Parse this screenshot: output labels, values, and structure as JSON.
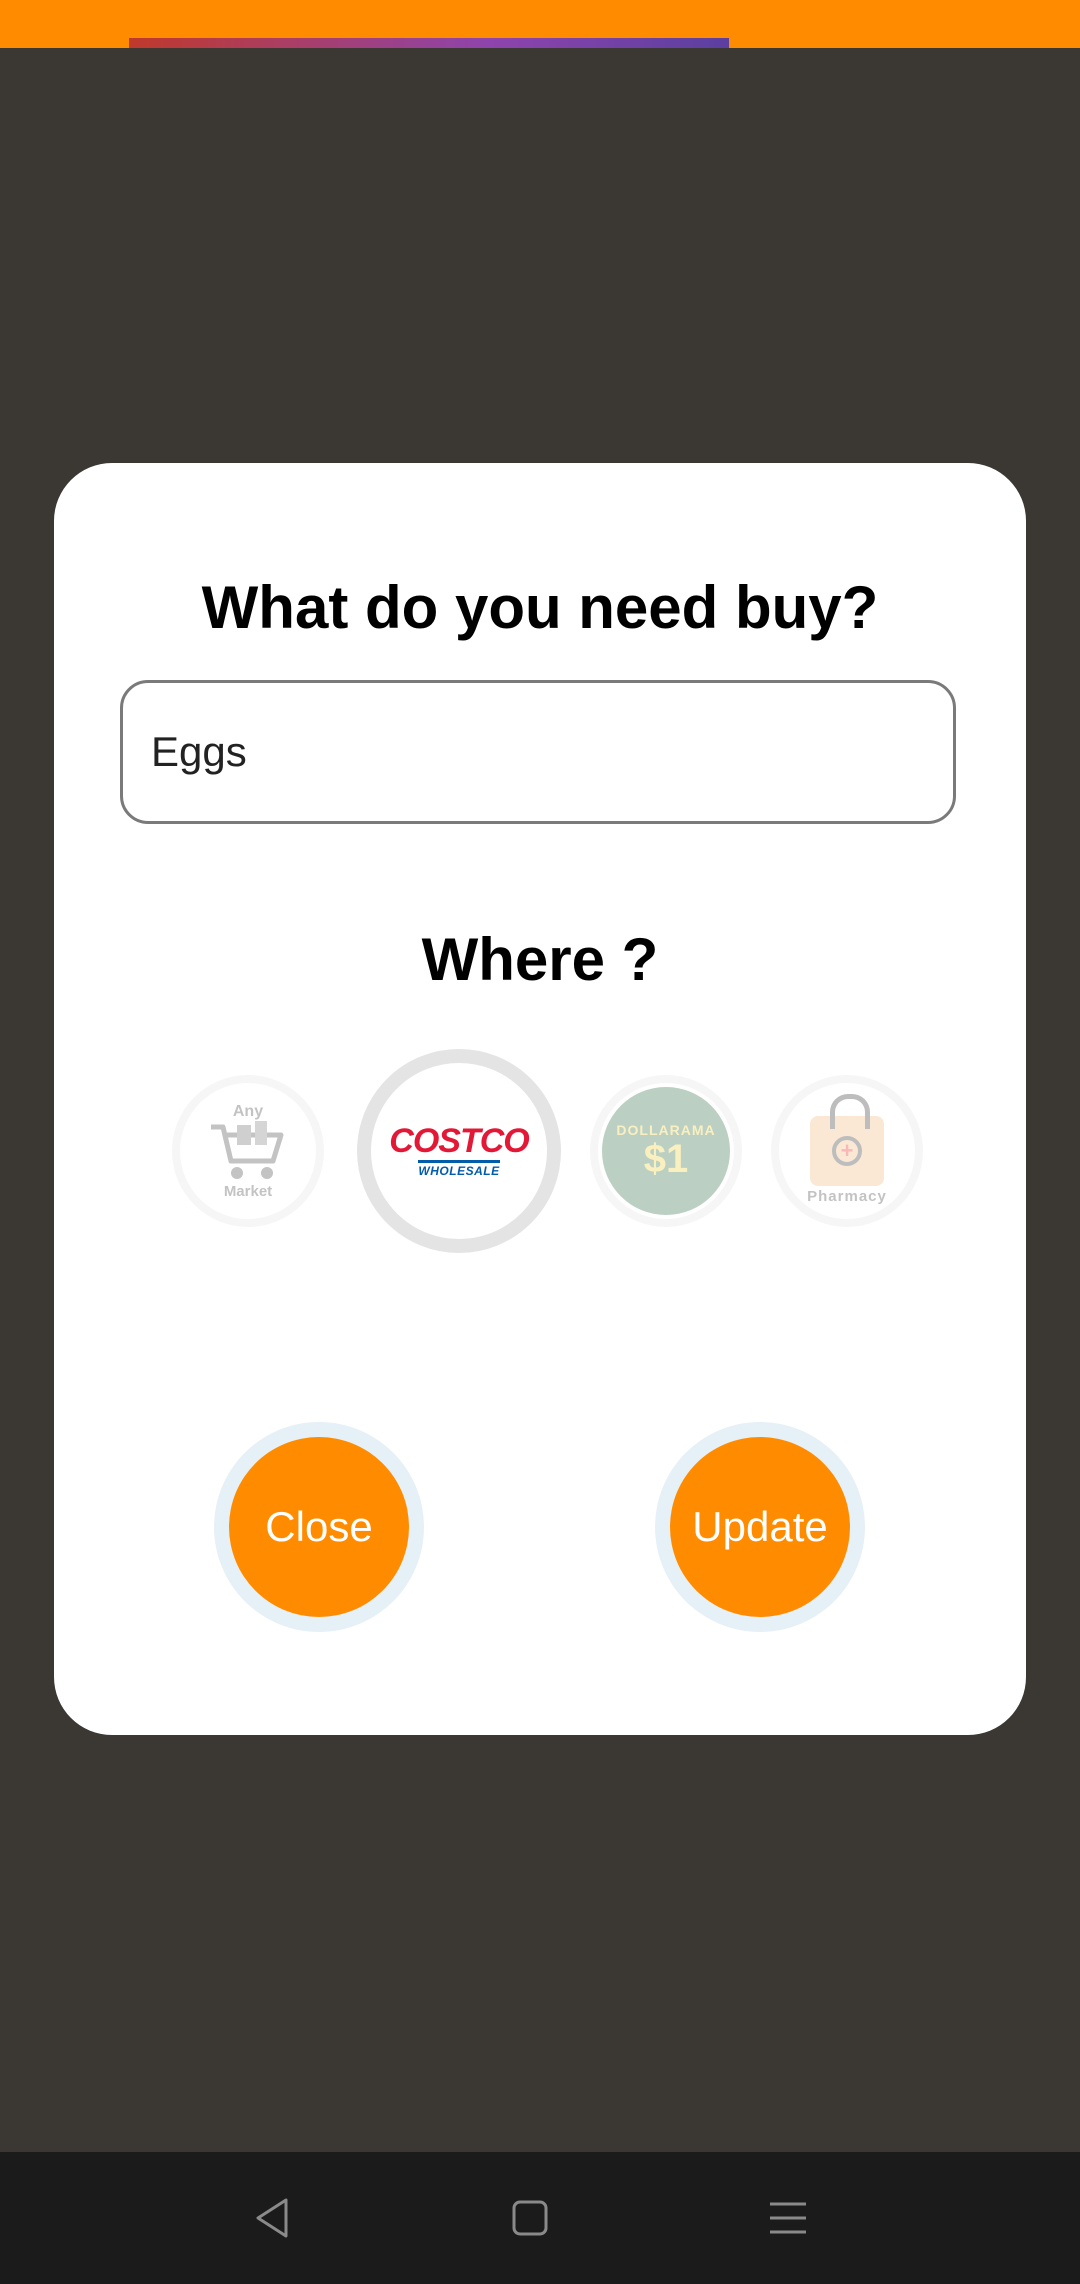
{
  "dialog": {
    "title": "What do you need buy?",
    "item_input": {
      "value": "Eggs",
      "placeholder": ""
    },
    "where_title": "Where ?",
    "stores": [
      {
        "name": "Any Market",
        "line1": "Any",
        "line2": "Market",
        "icon": "shopping-cart-icon",
        "selected": false
      },
      {
        "name": "Costco Wholesale",
        "word": "COSTCO",
        "sub": "WHOLESALE",
        "selected": true
      },
      {
        "name": "Dollarama",
        "word": "DOLLARAMA",
        "price": "$1",
        "selected": false
      },
      {
        "name": "Pharmacy",
        "label": "Pharmacy",
        "icon": "pharmacy-bag-icon",
        "selected": false
      }
    ],
    "close_label": "Close",
    "update_label": "Update"
  },
  "colors": {
    "accent": "#ff8c00",
    "backdrop": "#3b3733",
    "costco_red": "#e31837",
    "costco_blue": "#005daa"
  },
  "navigation": {
    "back_icon": "back-triangle-icon",
    "home_icon": "home-square-icon",
    "menu_icon": "menu-lines-icon"
  }
}
